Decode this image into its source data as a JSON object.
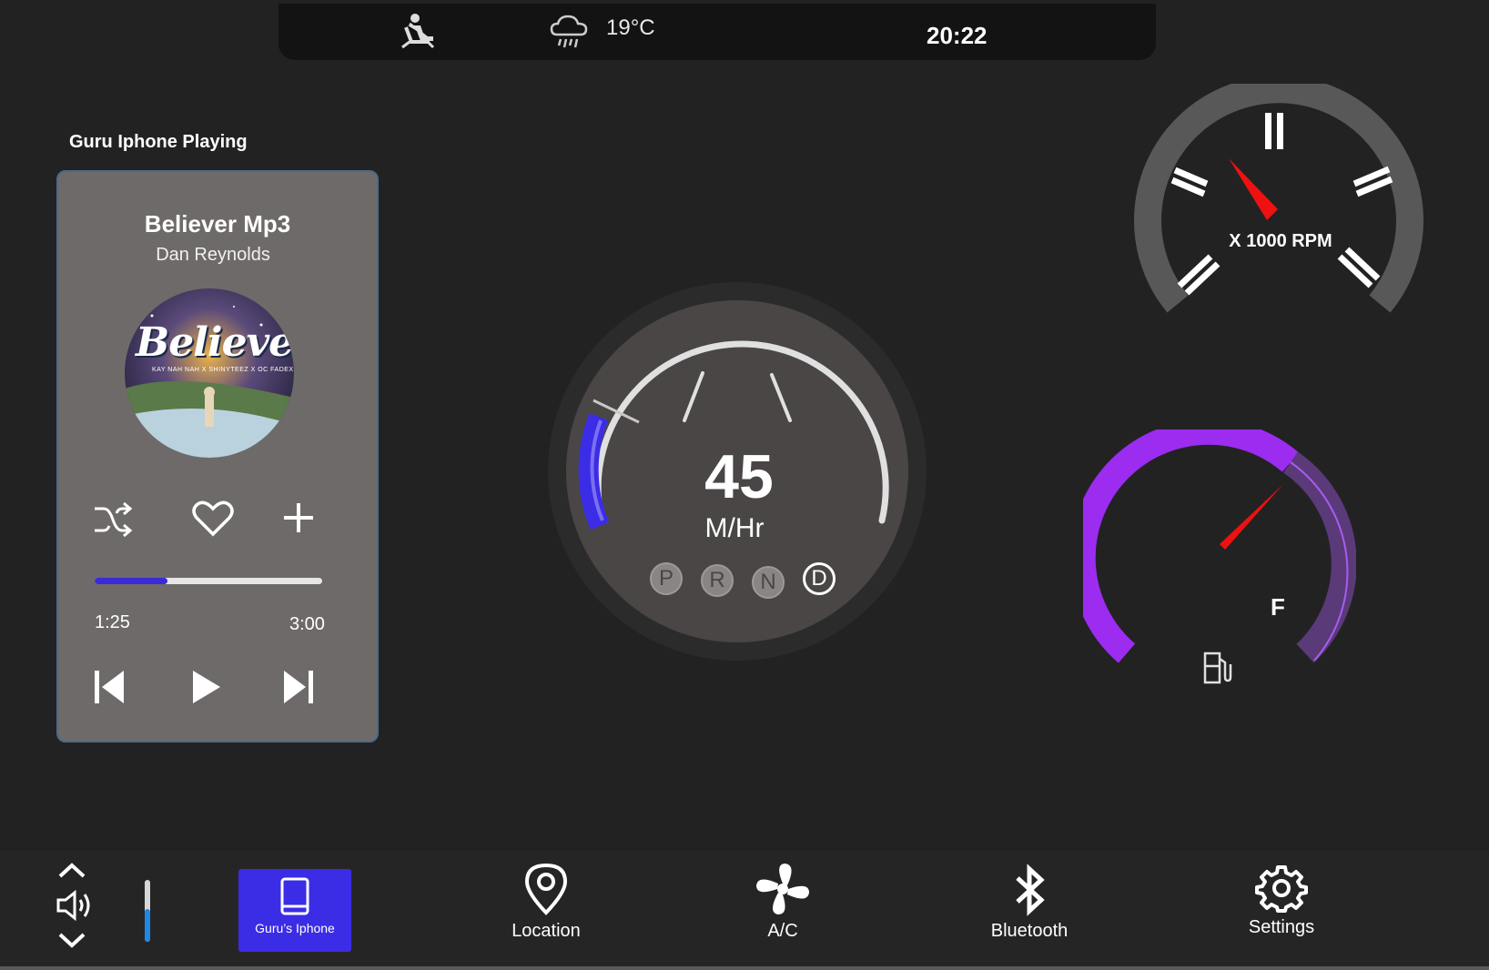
{
  "status": {
    "temperature": "19°C",
    "time": "20:22",
    "icons": [
      "seatbelt-warning-icon",
      "rain-cloud-icon"
    ]
  },
  "media": {
    "heading": "Guru Iphone Playing",
    "title": "Believer Mp3",
    "artist": "Dan Reynolds",
    "album_art_text": "Believer",
    "album_art_subtext": "KAY NAH NAH X SHINYTEEZ X OC FADEX",
    "elapsed": "1:25",
    "total": "3:00",
    "progress": 0.32,
    "icons": [
      "shuffle-icon",
      "heart-icon",
      "plus-icon",
      "previous-icon",
      "play-icon",
      "next-icon"
    ]
  },
  "speedometer": {
    "value": "45",
    "unit": "M/Hr",
    "gears": [
      "P",
      "R",
      "N",
      "D"
    ],
    "active_gear": "D"
  },
  "tachometer": {
    "label": "X 1000 RPM"
  },
  "fuel": {
    "label": "F",
    "icon": "fuel-pump-icon"
  },
  "bottom_nav": {
    "device_label": "Guru’s Iphone",
    "location": "Location",
    "ac": "A/C",
    "bluetooth": "Bluetooth",
    "settings": "Settings"
  },
  "colors": {
    "background": "#232223",
    "accent_blue": "#3b2ce6",
    "fuel_purple": "#9b2cf0",
    "needle_red": "#ee1111",
    "volume_blue": "#1e88e5"
  }
}
